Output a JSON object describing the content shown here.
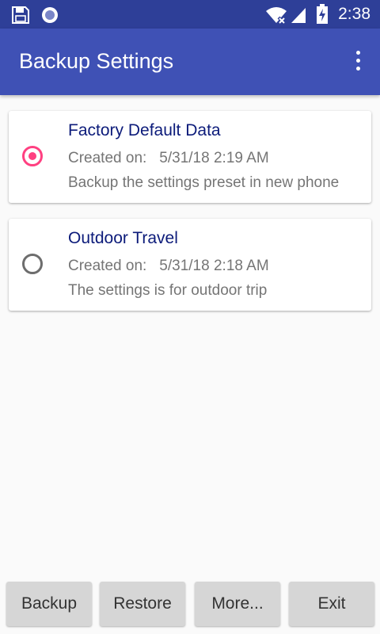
{
  "status_bar": {
    "time": "2:38",
    "icons": [
      "floppy-disk-icon",
      "circle-notification-icon",
      "wifi-x-icon",
      "cell-signal-icon",
      "battery-charging-icon"
    ]
  },
  "app_bar": {
    "title": "Backup Settings",
    "overflow_icon": "more-vert-icon"
  },
  "backups": [
    {
      "name": "Factory Default Data",
      "created_label": "Created on:",
      "created_date": "5/31/18 2:19 AM",
      "description": "Backup the settings preset in new phone",
      "selected": true
    },
    {
      "name": "Outdoor Travel",
      "created_label": "Created on:",
      "created_date": "5/31/18 2:18 AM",
      "description": "The settings is for outdoor trip",
      "selected": false
    }
  ],
  "buttons": {
    "backup": "Backup",
    "restore": "Restore",
    "more": "More...",
    "exit": "Exit"
  },
  "colors": {
    "status_bar": "#2e3f98",
    "app_bar": "#3f51b5",
    "accent": "#ff4081",
    "title_text": "#0c1b7a"
  }
}
